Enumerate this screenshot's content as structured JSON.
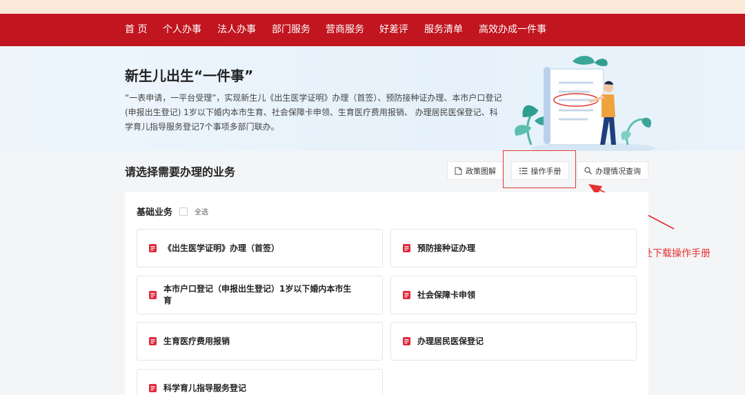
{
  "nav": {
    "items": [
      "首 页",
      "个人办事",
      "法人办事",
      "部门服务",
      "营商服务",
      "好差评",
      "服务清单",
      "高效办成一件事"
    ]
  },
  "hero": {
    "title": "新生儿出生“一件事”",
    "description": "“一表申请，一平台受理”，实现新生儿《出生医学证明》办理（首签）、预防接种证办理、本市户口登记(申报出生登记) 1岁以下婚内本市生育、社会保障卡申领、生育医疗费用报销、 办理居民医保登记、科学育儿指导服务登记7个事项多部门联办。"
  },
  "section": {
    "title": "请选择需要办理的业务",
    "buttons": {
      "policy": "政策图解",
      "manual": "操作手册",
      "query": "办理情况查询"
    }
  },
  "panel": {
    "title": "基础业务",
    "select_all": "全选",
    "items": [
      "《出生医学证明》办理（首签）",
      "预防接种证办理",
      "本市户口登记（申报出生登记）1岁以下婚内本市生育",
      "社会保障卡申领",
      "生育医疗费用报销",
      "办理居民医保登记",
      "科学育儿指导服务登记"
    ]
  },
  "annotation": {
    "text": "点击此处下载操作手册"
  },
  "colors": {
    "brand_red": "#c1151f",
    "annotation_red": "#e53030",
    "doc_icon_red": "#e0283a"
  },
  "icons": {
    "policy": "document-icon",
    "manual": "list-icon",
    "query": "search-icon",
    "item": "red-document-icon"
  }
}
